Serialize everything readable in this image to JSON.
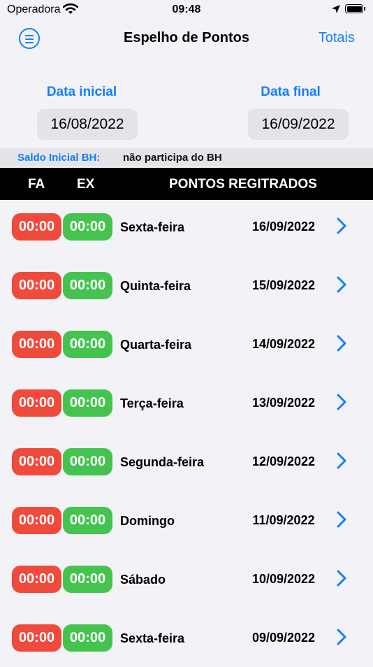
{
  "status_bar": {
    "carrier": "Operadora",
    "time": "09:48"
  },
  "nav": {
    "title": "Espelho de Pontos",
    "right_button": "Totais"
  },
  "filters": {
    "start_label": "Data inicial",
    "start_value": "16/08/2022",
    "end_label": "Data final",
    "end_value": "16/09/2022"
  },
  "saldo": {
    "label": "Saldo Inicial BH:",
    "value": "não participa do BH"
  },
  "table_header": {
    "fa": "FA",
    "ex": "EX",
    "pontos": "PONTOS REGITRADOS"
  },
  "colors": {
    "accent": "#147efb",
    "fa_badge": "#f04a3c",
    "ex_badge": "#44c44f"
  },
  "rows": [
    {
      "fa": "00:00",
      "ex": "00:00",
      "weekday": "Sexta-feira",
      "date": "16/09/2022"
    },
    {
      "fa": "00:00",
      "ex": "00:00",
      "weekday": "Quinta-feira",
      "date": "15/09/2022"
    },
    {
      "fa": "00:00",
      "ex": "00:00",
      "weekday": "Quarta-feira",
      "date": "14/09/2022"
    },
    {
      "fa": "00:00",
      "ex": "00:00",
      "weekday": "Terça-feira",
      "date": "13/09/2022"
    },
    {
      "fa": "00:00",
      "ex": "00:00",
      "weekday": "Segunda-feira",
      "date": "12/09/2022"
    },
    {
      "fa": "00:00",
      "ex": "00:00",
      "weekday": "Domingo",
      "date": "11/09/2022"
    },
    {
      "fa": "00:00",
      "ex": "00:00",
      "weekday": "Sábado",
      "date": "10/09/2022"
    },
    {
      "fa": "00:00",
      "ex": "00:00",
      "weekday": "Sexta-feira",
      "date": "09/09/2022"
    }
  ]
}
